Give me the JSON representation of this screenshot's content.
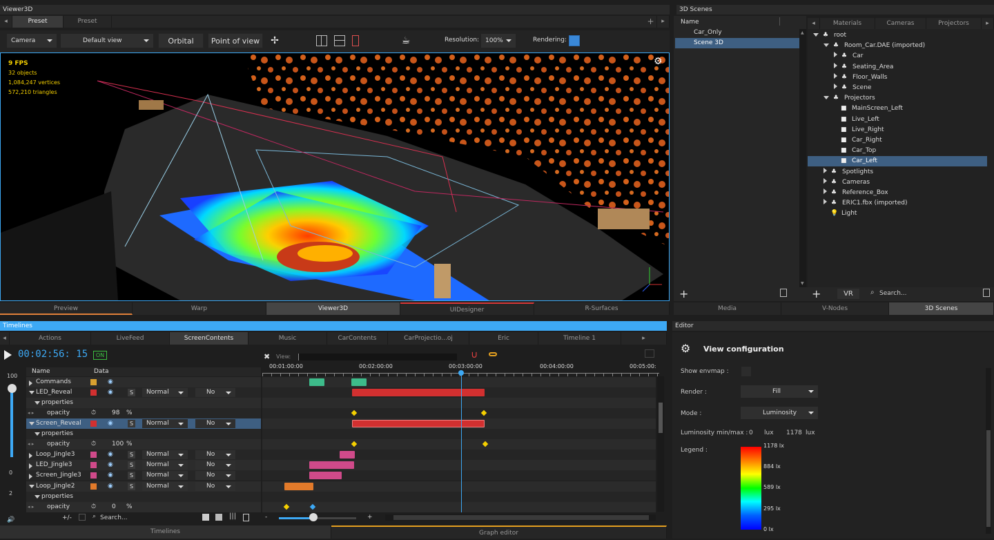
{
  "viewer": {
    "title": "Viewer3D",
    "preset_tabs": [
      "Preset",
      "Preset"
    ],
    "toolbar": {
      "camera": "Camera",
      "view": "Default view",
      "orbital": "Orbital",
      "point_of_view": "Point of view",
      "resolution_label": "Resolution:",
      "resolution_value": "100%",
      "rendering_label": "Rendering:"
    },
    "stats": {
      "fps": "9 FPS",
      "objects": "32 objects",
      "vertices": "1,084,247 vertices",
      "triangles": "572,210 triangles"
    },
    "bottom_tabs": [
      "Preview",
      "Warp",
      "Viewer3D",
      "UIDesigner",
      "R-Surfaces"
    ]
  },
  "scenes": {
    "title": "3D Scenes",
    "list_header": "Name",
    "items": [
      "Car_Only",
      "Scene 3D"
    ],
    "tabs": [
      "Materials",
      "Cameras",
      "Projectors"
    ],
    "tree": [
      {
        "label": "root",
        "depth": 0,
        "open": true
      },
      {
        "label": "Room_Car.DAE (imported)",
        "depth": 1,
        "open": true
      },
      {
        "label": "Car",
        "depth": 2,
        "open": false
      },
      {
        "label": "Seating_Area",
        "depth": 2,
        "open": false
      },
      {
        "label": "Floor_Walls",
        "depth": 2,
        "open": false
      },
      {
        "label": "Scene",
        "depth": 2,
        "open": false
      },
      {
        "label": "Projectors",
        "depth": 1,
        "open": true
      },
      {
        "label": "MainScreen_Left",
        "depth": 2,
        "leaf": true
      },
      {
        "label": "Live_Left",
        "depth": 2,
        "leaf": true
      },
      {
        "label": "Live_Right",
        "depth": 2,
        "leaf": true
      },
      {
        "label": "Car_Right",
        "depth": 2,
        "leaf": true
      },
      {
        "label": "Car_Top",
        "depth": 2,
        "leaf": true
      },
      {
        "label": "Car_Left",
        "depth": 2,
        "leaf": true,
        "selected": true
      },
      {
        "label": "Spotlights",
        "depth": 1,
        "open": false
      },
      {
        "label": "Cameras",
        "depth": 1,
        "open": false
      },
      {
        "label": "Reference_Box",
        "depth": 1,
        "open": false
      },
      {
        "label": "ERIC1.fbx (imported)",
        "depth": 1,
        "open": false
      },
      {
        "label": "Light",
        "depth": 1,
        "leaf": true,
        "light": true
      }
    ],
    "vr": "VR",
    "search": "Search...",
    "bottom_tabs": [
      "Media",
      "V-Nodes",
      "3D Scenes"
    ]
  },
  "timelines": {
    "title": "Timelines",
    "tabs": [
      "Actions",
      "LiveFeed",
      "ScreenContents",
      "Music",
      "CarContents",
      "CarProjectio...oj imported)",
      "Eric",
      "Timeline 1"
    ],
    "timecode": "00:02:56: 15",
    "on": "ON",
    "view_label": "View:",
    "col_name": "Name",
    "col_data": "Data",
    "ruler": [
      "00:01:00:00",
      "00:02:00:00",
      "00:03:00:00",
      "00:04:00:00",
      "00:05:00:"
    ],
    "vol_top": "100",
    "vol_mid": "0",
    "vol_low": "2",
    "rows": [
      {
        "name": "Commands",
        "color": "#d9a030",
        "type": "layer"
      },
      {
        "name": "LED_Reveal",
        "color": "#d23030",
        "type": "layer",
        "blend": "Normal",
        "mode": "No",
        "open": true
      },
      {
        "name": "properties",
        "type": "group"
      },
      {
        "name": "opacity",
        "type": "prop",
        "value": "98",
        "unit": "%"
      },
      {
        "name": "Screen_Reveal",
        "color": "#d23030",
        "type": "layer",
        "blend": "Normal",
        "mode": "No",
        "open": true,
        "selected": true
      },
      {
        "name": "properties",
        "type": "group"
      },
      {
        "name": "opacity",
        "type": "prop",
        "value": "100",
        "unit": "%"
      },
      {
        "name": "Loop_Jingle3",
        "color": "#d04a8a",
        "type": "layer",
        "blend": "Normal",
        "mode": "No"
      },
      {
        "name": "LED_Jingle3",
        "color": "#d04a8a",
        "type": "layer",
        "blend": "Normal",
        "mode": "No"
      },
      {
        "name": "Screen_Jingle3",
        "color": "#d04a8a",
        "type": "layer",
        "blend": "Normal",
        "mode": "No"
      },
      {
        "name": "Loop_Jingle2",
        "color": "#e27a2a",
        "type": "layer",
        "blend": "Normal",
        "mode": "No",
        "open": true
      },
      {
        "name": "properties",
        "type": "group"
      },
      {
        "name": "opacity",
        "type": "prop",
        "value": "0",
        "unit": "%"
      }
    ],
    "plusminus": "+/-",
    "search": "Search...",
    "s_label": "S",
    "bottom_tabs": [
      "Timelines",
      "Graph editor"
    ]
  },
  "editor": {
    "title": "Editor",
    "heading": "View configuration",
    "show_envmap": "Show envmap :",
    "render_label": "Render :",
    "render_value": "Fill",
    "mode_label": "Mode :",
    "mode_value": "Luminosity",
    "lum_label": "Luminosity min/max :",
    "lum_min": "0",
    "lum_max": "1178",
    "lux": "lux",
    "legend_label": "Legend :",
    "legend_ticks": [
      "1178 lx",
      "884 lx",
      "589 lx",
      "295 lx",
      "0 lx"
    ]
  },
  "colors": {
    "accent": "#3da9f5",
    "selection": "#3e5f82"
  }
}
